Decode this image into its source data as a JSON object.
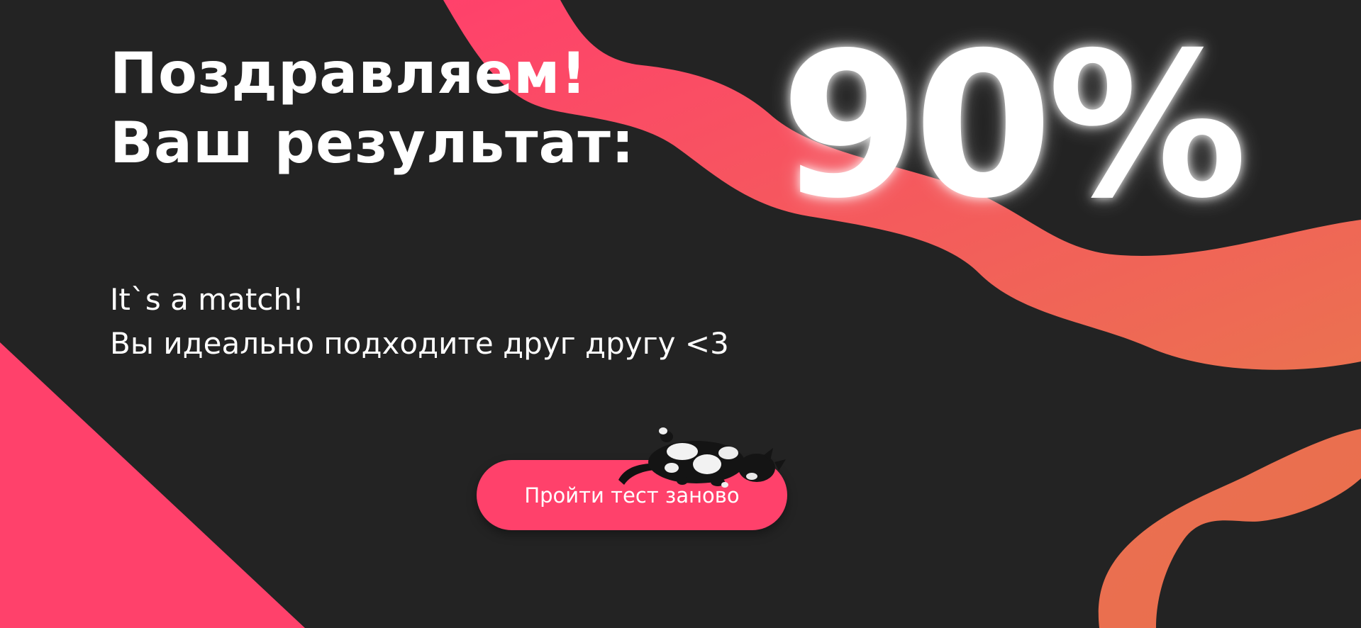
{
  "result": {
    "headline_line1": "Поздравляем!",
    "headline_line2": "Ваш результат:",
    "percent": "90%",
    "match_line1": "It`s a match!",
    "match_line2": "Вы идеально подходите друг другу <3"
  },
  "actions": {
    "retry_label": "Пройти тест заново"
  },
  "colors": {
    "background": "#232323",
    "accent_pink": "#ff416b",
    "accent_orange": "#eb7150",
    "text": "#ffffff"
  },
  "icons": {
    "mascot": "cat-image"
  }
}
